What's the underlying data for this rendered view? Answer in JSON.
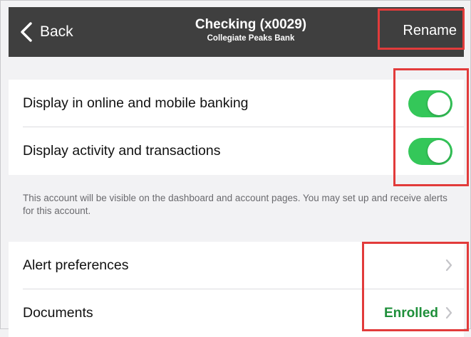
{
  "header": {
    "back_label": "Back",
    "title": "Checking (x0029)",
    "subtitle": "Collegiate Peaks Bank",
    "rename_label": "Rename"
  },
  "visibility": {
    "items": [
      {
        "label": "Display in online and mobile banking",
        "enabled": true
      },
      {
        "label": "Display activity and transactions",
        "enabled": true
      }
    ],
    "note": "This account will be visible on the dashboard and account pages. You may set up and receive alerts for this account."
  },
  "settings": {
    "alert_preferences_label": "Alert preferences",
    "documents_label": "Documents",
    "documents_status": "Enrolled"
  },
  "colors": {
    "navbar": "#3f3f3f",
    "toggle_on": "#34c759",
    "enrolled_text": "#1e8f3a",
    "highlight": "#e23b3b"
  },
  "icons": {
    "back": "chevron-left-icon",
    "row_nav": "chevron-right-icon"
  }
}
